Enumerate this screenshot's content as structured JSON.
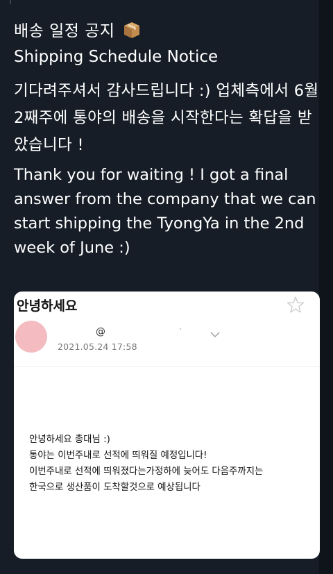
{
  "tweet": {
    "title_ko": "배송 일정 공지",
    "title_icon": "package-box-icon",
    "title_en": "Shipping Schedule Notice",
    "message_ko": "기다려주셔서 감사드립니다 :) 업체측에서 6월 2째주에 통야의 배송을 시작한다는 확답을 받았습니다 !",
    "message_en": "Thank you for waiting !  I got a final answer from the company that we can start shipping the TyongYa in the 2nd week of June :)"
  },
  "email": {
    "subject": "안녕하세요",
    "sender_at": "@",
    "date": "2021.05.24 17:58",
    "body_lines": [
      "안녕하세요 총대님 :)",
      "통야는 이번주내로 선적에 띄워질 예정입니다!",
      "이번주내로 선적에 띄워졌다는가정하에 늦어도 다음주까지는",
      "한국으로 생산품이 도착할것으로 예상됩니다"
    ],
    "avatar_color": "#f4bcc0",
    "star_icon": "star-outline-icon",
    "chevron_icon": "chevron-down-icon"
  },
  "colors": {
    "background": "#161d27",
    "card": "#ffffff",
    "text": "#ffffff"
  }
}
